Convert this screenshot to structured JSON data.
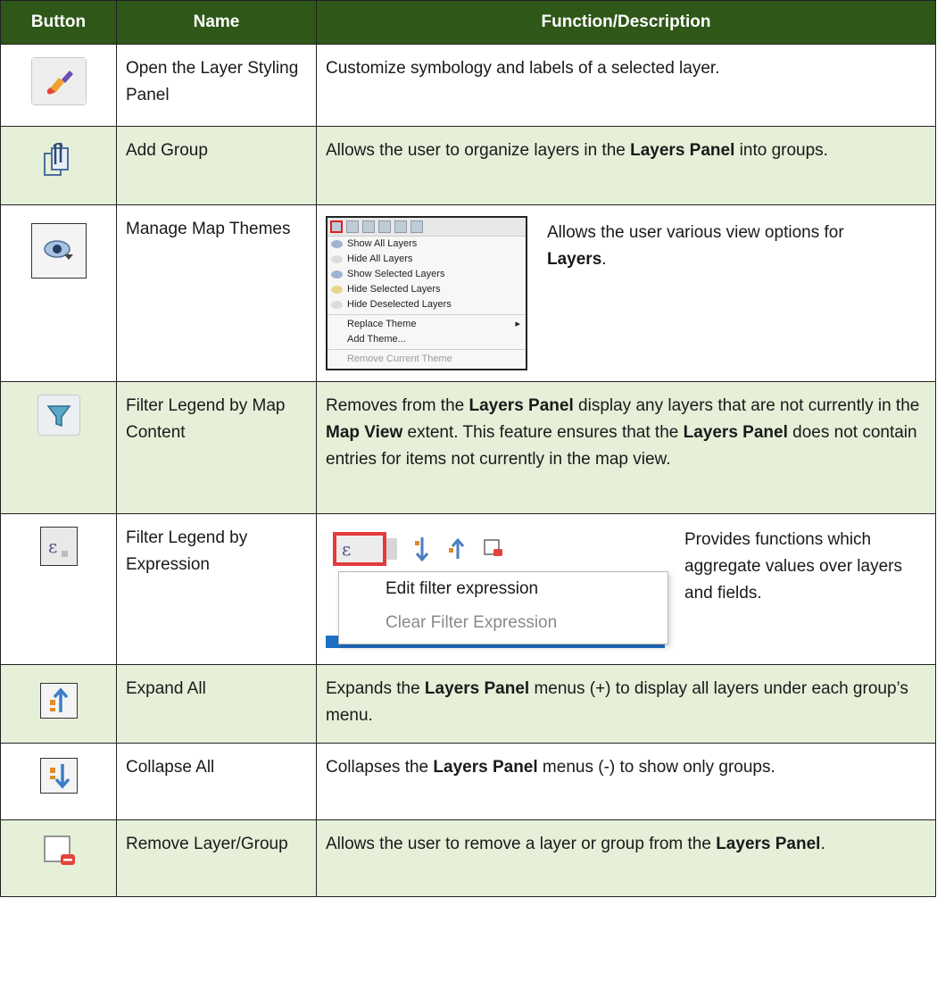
{
  "table": {
    "headers": {
      "button": "Button",
      "name": "Name",
      "function": "Function/Description"
    },
    "rows": [
      {
        "icon": "paintbrush-icon",
        "name": "Open the Layer Styling Panel",
        "desc": [
          {
            "t": "Customize symbology and labels of a selected layer."
          }
        ]
      },
      {
        "icon": "add-group-icon",
        "name": "Add Group",
        "desc": [
          {
            "t": "Allows the user to organize layers in the "
          },
          {
            "b": "Layers Panel"
          },
          {
            "t": " into groups."
          }
        ]
      },
      {
        "icon": "eye-icon",
        "name": "Manage Map Themes",
        "desc": [
          {
            "t": "Allows the user various view options for "
          },
          {
            "b": "Layers"
          },
          {
            "t": "."
          }
        ],
        "menu_items": [
          "Show All Layers",
          "Hide All Layers",
          "Show Selected Layers",
          "Hide Selected Layers",
          "Hide Deselected Layers",
          "Replace Theme",
          "Add Theme...",
          "Remove Current Theme"
        ]
      },
      {
        "icon": "filter-icon",
        "name": "Filter Legend by Map Content",
        "desc": [
          {
            "t": "Removes from the "
          },
          {
            "b": "Layers Panel"
          },
          {
            "t": " display any layers that are not currently in the "
          },
          {
            "b": "Map View"
          },
          {
            "t": " extent. This feature ensures that the "
          },
          {
            "b": "Layers Panel"
          },
          {
            "t": " does not contain entries for items not currently in the map view."
          }
        ]
      },
      {
        "icon": "epsilon-filter-icon",
        "name": "Filter Legend by Expression",
        "desc": [
          {
            "t": "Provides functions which aggregate values over layers and fields."
          }
        ],
        "popup": [
          "Edit filter expression",
          "Clear Filter Expression"
        ]
      },
      {
        "icon": "expand-all-icon",
        "name": "Expand All",
        "desc": [
          {
            "t": "Expands the "
          },
          {
            "b": "Layers Panel"
          },
          {
            "t": " menus (+) to display all layers under each group’s menu."
          }
        ]
      },
      {
        "icon": "collapse-all-icon",
        "name": "Collapse All",
        "desc": [
          {
            "t": "Collapses the "
          },
          {
            "b": "Layers Panel"
          },
          {
            "t": " menus (-) to show only groups."
          }
        ]
      },
      {
        "icon": "remove-layer-icon",
        "name": "Remove Layer/Group",
        "desc": [
          {
            "t": "Allows the user to remove a layer or group from the "
          },
          {
            "b": "Layers Panel"
          },
          {
            "t": "."
          }
        ]
      }
    ]
  },
  "colors": {
    "header_bg": "#2e5718",
    "alt_row_bg": "#e6efd8",
    "highlight_red": "#e33b3b"
  }
}
